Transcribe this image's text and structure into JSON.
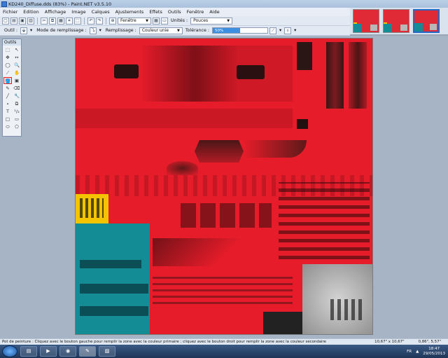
{
  "window": {
    "title": "KD240_Diffuse.dds (83%) - Paint.NET v3.5.10"
  },
  "menu": {
    "items": [
      "Fichier",
      "Edition",
      "Affichage",
      "Image",
      "Calques",
      "Ajustements",
      "Effets",
      "Outils",
      "Fenêtre",
      "Aide"
    ]
  },
  "toolbar": {
    "window_dropdown": "Fenêtre",
    "units_label": "Unités :",
    "units_value": "Pouces"
  },
  "options_bar": {
    "tool_label": "Outil :",
    "fill_mode_label": "Mode de remplissage :",
    "fill_label": "Remplissage :",
    "fill_value": "Couleur unie",
    "tolerance_label": "Tolérance :",
    "tolerance_value": "50%",
    "tolerance_fraction": 0.5
  },
  "tools": {
    "title": "Outils",
    "items": [
      "⬚",
      "↖",
      "✥",
      "↔",
      "◯",
      "🔍",
      "⟋",
      "✋",
      "🪣",
      "▣",
      "✎",
      "⌫",
      "╱",
      "🔧",
      "⬩",
      "⧉",
      "T",
      "¹/₂",
      "□",
      "▭",
      "⬭",
      "⬠"
    ]
  },
  "status": {
    "message": "Pot de peinture : Cliquez avec le bouton gauche pour remplir la zone avec la couleur primaire ; cliquez avec le bouton droit pour remplir la zone avec la couleur secondaire",
    "size": "10,67\" x 10,67\"",
    "cursor": "0,86\", 5,57\""
  },
  "taskbar": {
    "tray_text": "FR",
    "time": "18:47",
    "date": "29/05/2013"
  },
  "colors": {
    "texture_red": "#e61c2a",
    "texture_cyan": "#138c96",
    "texture_yellow": "#f5c400",
    "texture_grey": "#b8b8b8"
  }
}
